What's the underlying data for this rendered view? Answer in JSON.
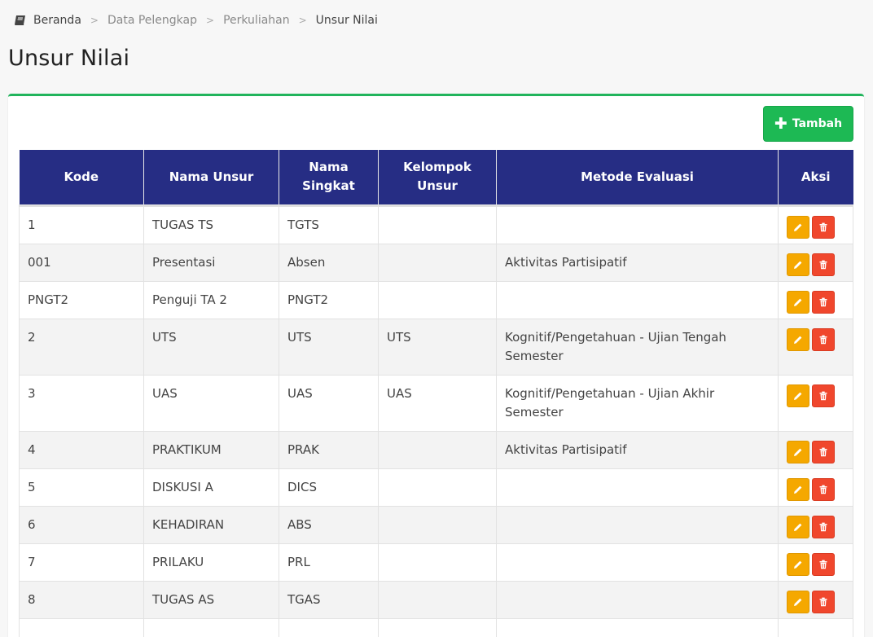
{
  "breadcrumb": {
    "items": [
      "Beranda",
      "Data Pelengkap",
      "Perkuliahan",
      "Unsur Nilai"
    ],
    "separator": ">"
  },
  "page_title": "Unsur Nilai",
  "toolbar": {
    "add_label": "Tambah",
    "add_icon": "plus-icon"
  },
  "table": {
    "header_color": "#262d84",
    "columns": [
      "Kode",
      "Nama Unsur",
      "Nama Singkat",
      "Kelompok Unsur",
      "Metode Evaluasi",
      "Aksi"
    ],
    "rows": [
      {
        "kode": "1",
        "nama": "TUGAS TS",
        "singkat": "TGTS",
        "kelompok": "",
        "metode": ""
      },
      {
        "kode": "001",
        "nama": "Presentasi",
        "singkat": "Absen",
        "kelompok": "",
        "metode": "Aktivitas Partisipatif"
      },
      {
        "kode": "PNGT2",
        "nama": "Penguji TA 2",
        "singkat": "PNGT2",
        "kelompok": "",
        "metode": ""
      },
      {
        "kode": "2",
        "nama": "UTS",
        "singkat": "UTS",
        "kelompok": "UTS",
        "metode": "Kognitif/Pengetahuan - Ujian Tengah Semester"
      },
      {
        "kode": "3",
        "nama": "UAS",
        "singkat": "UAS",
        "kelompok": "UAS",
        "metode": "Kognitif/Pengetahuan - Ujian Akhir Semester"
      },
      {
        "kode": "4",
        "nama": "PRAKTIKUM",
        "singkat": "PRAK",
        "kelompok": "",
        "metode": "Aktivitas Partisipatif"
      },
      {
        "kode": "5",
        "nama": "DISKUSI A",
        "singkat": "DICS",
        "kelompok": "",
        "metode": ""
      },
      {
        "kode": "6",
        "nama": "KEHADIRAN",
        "singkat": "ABS",
        "kelompok": "",
        "metode": ""
      },
      {
        "kode": "7",
        "nama": "PRILAKU",
        "singkat": "PRL",
        "kelompok": "",
        "metode": ""
      },
      {
        "kode": "8",
        "nama": "TUGAS AS",
        "singkat": "TGAS",
        "kelompok": "",
        "metode": ""
      },
      {
        "kode": "",
        "nama": "",
        "singkat": "",
        "kelompok": "",
        "metode": ""
      }
    ]
  },
  "colors": {
    "accent": "#21b45c",
    "edit": "#f5a800",
    "delete": "#f0472d"
  }
}
